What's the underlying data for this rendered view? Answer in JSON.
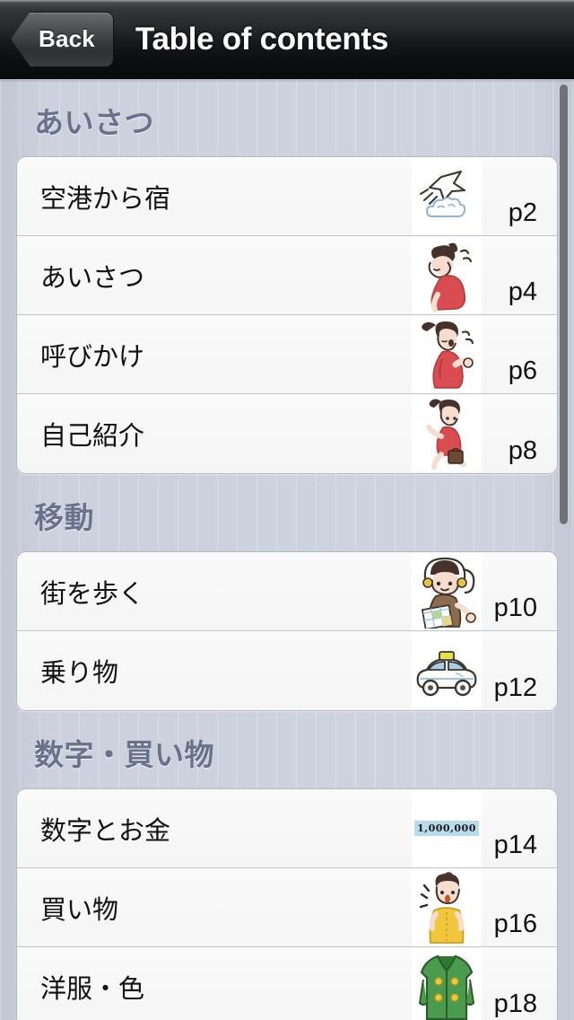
{
  "navbar": {
    "back_label": "Back",
    "title": "Table of contents",
    "back_icon": "chevron-left-icon"
  },
  "theme": {
    "page_background": "#cdd2de",
    "navbar_background": "#17181a",
    "row_background": "#f8f8f8",
    "section_header_color": "#69728a",
    "text_color": "#111111",
    "scrollbar_color": "#6f7277",
    "money_highlight": "#b9dced"
  },
  "scrollbar": {
    "visible": true,
    "position": "right"
  },
  "sections": [
    {
      "title": "あいさつ",
      "rows": [
        {
          "label": "空港から宿",
          "page": "p2",
          "thumb": "airplane-cloud-illustration"
        },
        {
          "label": "あいさつ",
          "page": "p4",
          "thumb": "girl-bowing-illustration"
        },
        {
          "label": "呼びかけ",
          "page": "p6",
          "thumb": "girl-calling-illustration"
        },
        {
          "label": "自己紹介",
          "page": "p8",
          "thumb": "girl-walking-bag-illustration"
        }
      ]
    },
    {
      "title": "移動",
      "rows": [
        {
          "label": "街を歩く",
          "page": "p10",
          "thumb": "girl-with-map-illustration"
        },
        {
          "label": "乗り物",
          "page": "p12",
          "thumb": "taxi-car-illustration"
        }
      ]
    },
    {
      "title": "数字・買い物",
      "rows": [
        {
          "label": "数字とお金",
          "page": "p14",
          "thumb": "money-number-illustration",
          "thumb_text": "1,000,000"
        },
        {
          "label": "買い物",
          "page": "p16",
          "thumb": "girl-yellow-top-illustration"
        },
        {
          "label": "洋服・色",
          "page": "p18",
          "thumb": "green-coat-illustration"
        }
      ]
    }
  ]
}
